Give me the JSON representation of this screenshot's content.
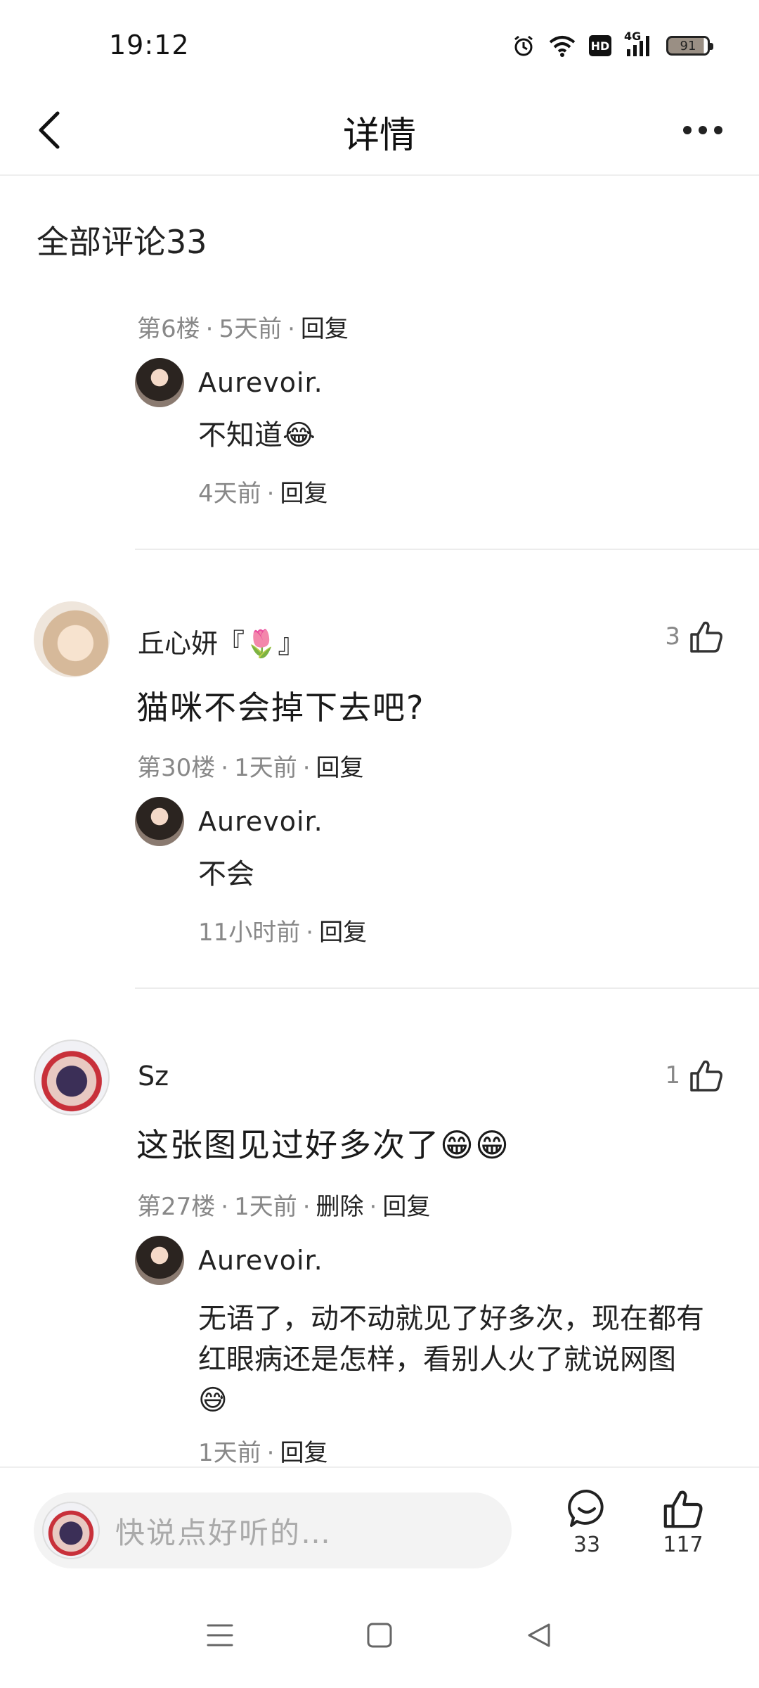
{
  "status_bar": {
    "time": "19:12",
    "battery_level": "91",
    "network": "4G",
    "hd_label": "HD"
  },
  "header": {
    "title": "详情"
  },
  "comments_section": {
    "title": "全部评论33"
  },
  "threads": [
    {
      "meta_floor": "第6楼",
      "meta_time": "5天前",
      "meta_reply": "回复",
      "reply": {
        "author": "Aurevoir.",
        "text": "不知道😂",
        "time": "4天前",
        "reply_label": "回复"
      }
    },
    {
      "author": "丘心妍『🌷』",
      "text": "猫咪不会掉下去吧?",
      "likes": "3",
      "meta_floor": "第30楼",
      "meta_time": "1天前",
      "meta_reply": "回复",
      "reply": {
        "author": "Aurevoir.",
        "text": "不会",
        "time": "11小时前",
        "reply_label": "回复"
      }
    },
    {
      "author": "Sz",
      "text": "这张图见过好多次了😁😁",
      "likes": "1",
      "meta_floor": "第27楼",
      "meta_time": "1天前",
      "meta_delete": "删除",
      "meta_reply": "回复",
      "reply": {
        "author": "Aurevoir.",
        "text": "无语了，动不动就见了好多次，现在都有红眼病还是怎样，看别人火了就说网图😅",
        "time": "1天前",
        "reply_label": "回复"
      }
    }
  ],
  "bottom_bar": {
    "input_placeholder": "快说点好听的…",
    "comment_count": "33",
    "like_count": "117"
  }
}
